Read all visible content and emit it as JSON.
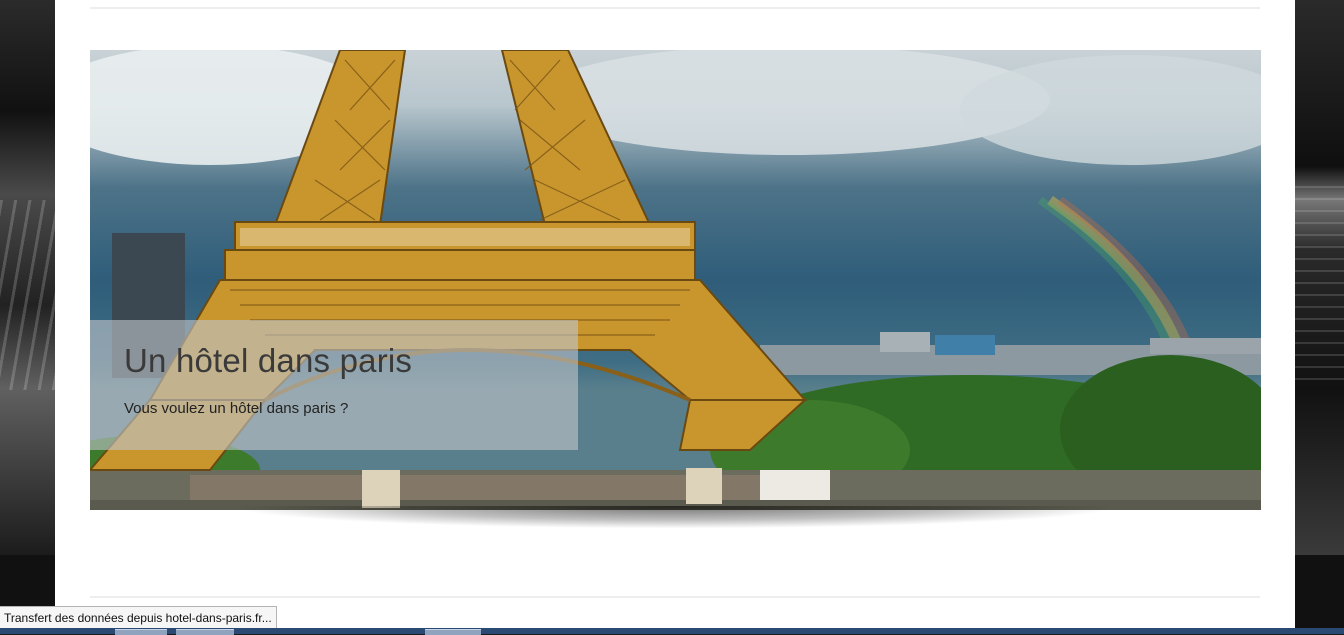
{
  "slider": {
    "title": "Un hôtel dans paris",
    "subtitle": "Vous voulez un hôtel dans paris ?"
  },
  "status_bar": {
    "text": "Transfert des données depuis hotel-dans-paris.fr..."
  },
  "colors": {
    "page_background": "#ffffff",
    "caption_overlay": "rgba(190,196,200,0.62)",
    "taskbar": "#2b4a73",
    "tower": "#c9962e"
  },
  "icons": [
    "eiffel-tower-image"
  ]
}
